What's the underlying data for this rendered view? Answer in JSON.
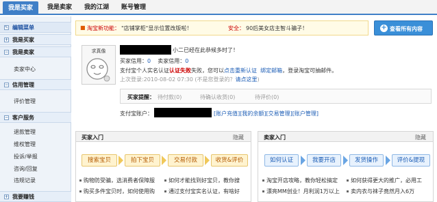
{
  "nav": {
    "tabs": [
      "我是买家",
      "我是卖家",
      "我的江湖",
      "账号管理"
    ]
  },
  "sidebar": {
    "edit": "编辑菜单",
    "sections": [
      {
        "title": "我是买家",
        "items": []
      },
      {
        "title": "我是卖家",
        "items": [
          "卖家中心"
        ]
      },
      {
        "title": "信用管理",
        "items": [
          "评价管理"
        ]
      },
      {
        "title": "客户服务",
        "items": [
          "退款管理",
          "维权管理",
          "投诉/举报",
          "咨询/回复",
          "违规记录"
        ]
      },
      {
        "title": "我要赚钱",
        "items": []
      }
    ]
  },
  "banner": {
    "new_feature_label": "淘宝新功能：",
    "new_feature_text": "\"店铺掌柜\"显示位置改版啦！",
    "security_label": "安全：",
    "security_text": "90后美女店主智斗骗子！"
  },
  "view_all_button": "查看所有内容",
  "profile": {
    "avatar_caption": "求真像",
    "greeting": "小二已经在此恭候多时了！",
    "buyer_credit_label": "买家信用：",
    "buyer_credit_value": "0",
    "seller_credit_label": "卖家信用：",
    "seller_credit_value": "0",
    "auth_prefix": "支付宝个人实名认证",
    "auth_status": "认证失败",
    "auth_mid": "失败，您可以",
    "auth_link": "点击重新认证",
    "bind_link": "绑定邮箱",
    "auth_suffix": "，登录淘宝可抽邮件。",
    "last_login_label": "上次登录:",
    "last_login_time": "2010-08-02 07:30",
    "not_you": "(不是您登录的？",
    "click_here": "请点这里",
    "not_you_close": ")"
  },
  "reminder": {
    "label": "买家提醒：",
    "items": [
      "待付款(0)",
      "待确认收货(0)",
      "待评价(0)"
    ]
  },
  "alipay": {
    "label": "支付宝账户：",
    "links": [
      "[账户充值]",
      "[我的余额]",
      "[交易管理]",
      "[账户管理]"
    ]
  },
  "buyer_intro": {
    "title": "买家入门",
    "hide": "隐藏",
    "steps": [
      "搜索宝贝",
      "拍下宝贝",
      "交易付款",
      "收货&评价"
    ],
    "tips": [
      "购物防受骗，选消费者保障服",
      "如何才能找到好宝贝，教你搜",
      "购买多件宝贝时，如何使用购",
      "通过支付宝实名认证，有啥好"
    ]
  },
  "seller_intro": {
    "title": "卖家入门",
    "hide": "隐藏",
    "steps": [
      "如何认证",
      "我要开店",
      "发货操作",
      "评价&提现"
    ],
    "tips": [
      "淘宝开店攻略，教你轻松搞定",
      "如何获得更大的推广，必用工",
      "漂亮MM创业！月利润1万以上",
      "卖内衣与袜子竟然月入6万"
    ]
  },
  "colors": {
    "accent": "#3f7fc7",
    "link": "#1b5cb5",
    "warn": "#cc0000"
  }
}
